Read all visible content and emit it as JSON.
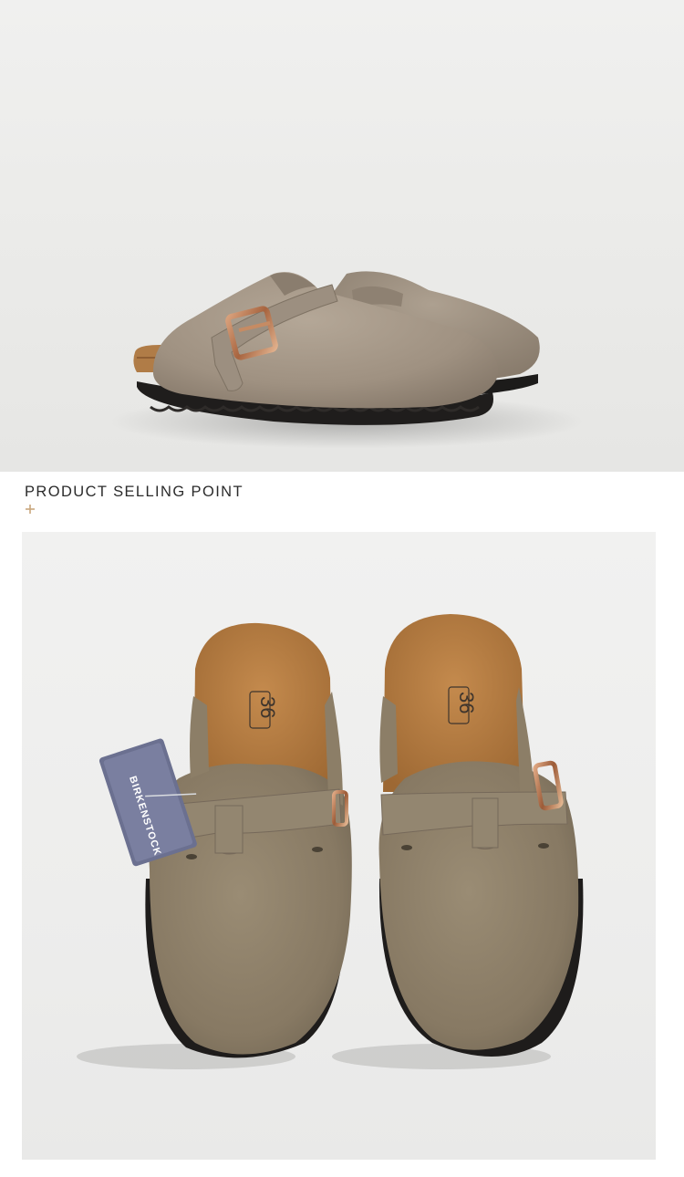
{
  "section": {
    "title": "PRODUCT SELLING POINT",
    "plus_icon": "plus-icon"
  },
  "hero_image": {
    "subject": "pair of suede clogs with buckle strap, side view",
    "colors": {
      "suede": "#a39585",
      "sole": "#1e1c1b",
      "cork": "#b07c47",
      "buckle": "#b5734f"
    }
  },
  "detail_image": {
    "subject": "pair of suede clogs, top view, with hang tag",
    "tag_text": "BIRKENSTOCK",
    "footbed_size_mark": "36",
    "colors": {
      "suede": "#8d7f68",
      "footbed": "#b5793e",
      "tag": "#6b7090"
    }
  },
  "colors": {
    "title_text": "#2b2b2b",
    "plus_accent": "#c9a77d"
  }
}
